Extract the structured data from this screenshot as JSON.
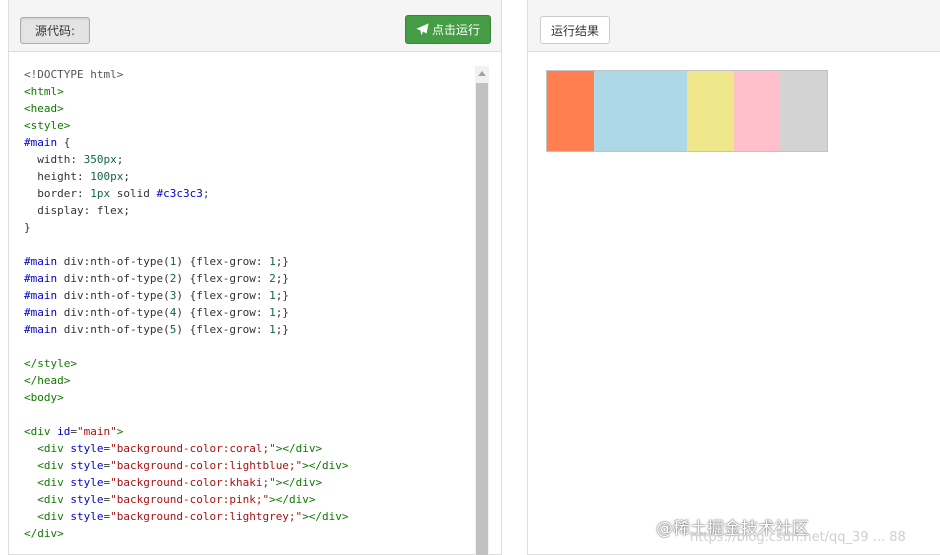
{
  "left": {
    "source_label": "源代码:",
    "run_label": "点击运行",
    "code_lines": [
      [
        [
          "meta",
          "<!DOCTYPE html>"
        ]
      ],
      [
        [
          "tag",
          "<html>"
        ]
      ],
      [
        [
          "tag",
          "<head>"
        ]
      ],
      [
        [
          "tag",
          "<style>"
        ]
      ],
      [
        [
          "sel",
          "#main"
        ],
        [
          "plain",
          " {"
        ]
      ],
      [
        [
          "plain",
          "  width: "
        ],
        [
          "num",
          "350px"
        ],
        [
          "plain",
          ";"
        ]
      ],
      [
        [
          "plain",
          "  height: "
        ],
        [
          "num",
          "100px"
        ],
        [
          "plain",
          ";"
        ]
      ],
      [
        [
          "plain",
          "  border: "
        ],
        [
          "num",
          "1px"
        ],
        [
          "plain",
          " solid "
        ],
        [
          "sel",
          "#c3c3c3"
        ],
        [
          "plain",
          ";"
        ]
      ],
      [
        [
          "plain",
          "  display: flex;"
        ]
      ],
      [
        [
          "plain",
          "}"
        ]
      ],
      [],
      [
        [
          "sel",
          "#main"
        ],
        [
          "plain",
          " div:nth-of-type("
        ],
        [
          "num",
          "1"
        ],
        [
          "plain",
          ") {flex-grow: "
        ],
        [
          "num",
          "1"
        ],
        [
          "plain",
          ";}"
        ]
      ],
      [
        [
          "sel",
          "#main"
        ],
        [
          "plain",
          " div:nth-of-type("
        ],
        [
          "num",
          "2"
        ],
        [
          "plain",
          ") {flex-grow: "
        ],
        [
          "num",
          "2"
        ],
        [
          "plain",
          ";}"
        ]
      ],
      [
        [
          "sel",
          "#main"
        ],
        [
          "plain",
          " div:nth-of-type("
        ],
        [
          "num",
          "3"
        ],
        [
          "plain",
          ") {flex-grow: "
        ],
        [
          "num",
          "1"
        ],
        [
          "plain",
          ";}"
        ]
      ],
      [
        [
          "sel",
          "#main"
        ],
        [
          "plain",
          " div:nth-of-type("
        ],
        [
          "num",
          "4"
        ],
        [
          "plain",
          ") {flex-grow: "
        ],
        [
          "num",
          "1"
        ],
        [
          "plain",
          ";}"
        ]
      ],
      [
        [
          "sel",
          "#main"
        ],
        [
          "plain",
          " div:nth-of-type("
        ],
        [
          "num",
          "5"
        ],
        [
          "plain",
          ") {flex-grow: "
        ],
        [
          "num",
          "1"
        ],
        [
          "plain",
          ";}"
        ]
      ],
      [],
      [
        [
          "tag",
          "</style>"
        ]
      ],
      [
        [
          "tag",
          "</head>"
        ]
      ],
      [
        [
          "tag",
          "<body>"
        ]
      ],
      [],
      [
        [
          "tag",
          "<div"
        ],
        [
          "plain",
          " "
        ],
        [
          "attr",
          "id"
        ],
        [
          "plain",
          "="
        ],
        [
          "str",
          "\"main\""
        ],
        [
          "tag",
          ">"
        ]
      ],
      [
        [
          "plain",
          "  "
        ],
        [
          "tag",
          "<div"
        ],
        [
          "plain",
          " "
        ],
        [
          "attr",
          "style"
        ],
        [
          "plain",
          "="
        ],
        [
          "str",
          "\"background-color:coral;\""
        ],
        [
          "tag",
          "></div>"
        ]
      ],
      [
        [
          "plain",
          "  "
        ],
        [
          "tag",
          "<div"
        ],
        [
          "plain",
          " "
        ],
        [
          "attr",
          "style"
        ],
        [
          "plain",
          "="
        ],
        [
          "str",
          "\"background-color:lightblue;\""
        ],
        [
          "tag",
          "></div>"
        ]
      ],
      [
        [
          "plain",
          "  "
        ],
        [
          "tag",
          "<div"
        ],
        [
          "plain",
          " "
        ],
        [
          "attr",
          "style"
        ],
        [
          "plain",
          "="
        ],
        [
          "str",
          "\"background-color:khaki;\""
        ],
        [
          "tag",
          "></div>"
        ]
      ],
      [
        [
          "plain",
          "  "
        ],
        [
          "tag",
          "<div"
        ],
        [
          "plain",
          " "
        ],
        [
          "attr",
          "style"
        ],
        [
          "plain",
          "="
        ],
        [
          "str",
          "\"background-color:pink;\""
        ],
        [
          "tag",
          "></div>"
        ]
      ],
      [
        [
          "plain",
          "  "
        ],
        [
          "tag",
          "<div"
        ],
        [
          "plain",
          " "
        ],
        [
          "attr",
          "style"
        ],
        [
          "plain",
          "="
        ],
        [
          "str",
          "\"background-color:lightgrey;\""
        ],
        [
          "tag",
          "></div>"
        ]
      ],
      [
        [
          "tag",
          "</div>"
        ]
      ]
    ]
  },
  "right": {
    "result_label": "运行结果",
    "boxes": [
      {
        "color": "#ff7f50",
        "grow": 1
      },
      {
        "color": "#add8e6",
        "grow": 2
      },
      {
        "color": "#f0e68c",
        "grow": 1
      },
      {
        "color": "#ffc0cb",
        "grow": 1
      },
      {
        "color": "#d3d3d3",
        "grow": 1
      }
    ]
  },
  "watermark": {
    "text": "@稀土掘金技术社区",
    "url": "https://blog.csdn.net/qq_39 ... 88"
  },
  "colors": {
    "run_button": "#449d44",
    "code_tag": "#117700",
    "code_selector": "#0000cc",
    "code_string": "#aa1111",
    "code_number": "#116644"
  }
}
